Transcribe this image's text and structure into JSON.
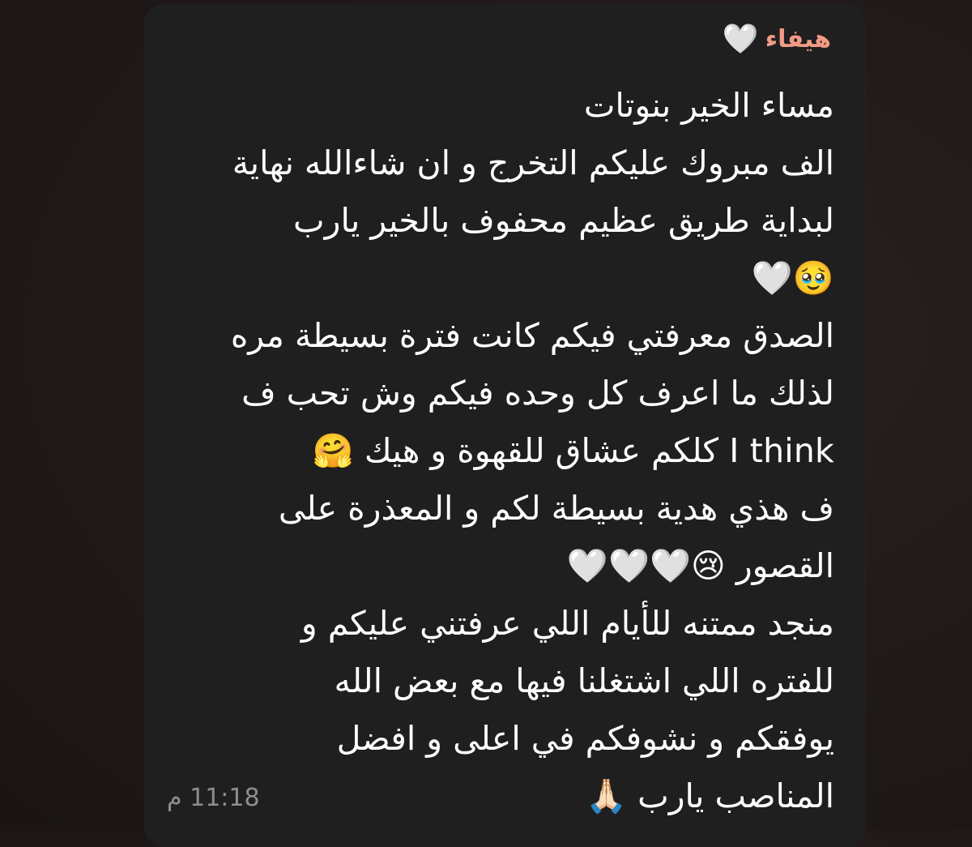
{
  "message": {
    "sender_name": "هيفاء",
    "sender_emoji": "heart-white-icon",
    "lines": [
      "مساء الخير بنوتات",
      "الف مبروك عليكم التخرج و ان شاءالله نهاية",
      "لبداية طريق عظيم محفوف بالخير يارب",
      "🥹🤍",
      "الصدق معرفتي فيكم كانت فترة بسيطة مره",
      "لذلك ما اعرف كل وحده فيكم وش تحب ف",
      "I think كلكم عشاق للقهوة و هيك 🤗",
      "ف هذي هدية بسيطة لكم و المعذرة على",
      "القصور 😢🤍🤍🤍",
      "منجد ممتنه للأيام اللي عرفتني عليكم و",
      "للفتره اللي اشتغلنا فيها مع بعض الله",
      "يوفقكم و نشوفكم في اعلى و افضل",
      "المناصب يارب 🙏🏻"
    ],
    "timestamp": "11:18 م"
  },
  "colors": {
    "background": "#221a1a",
    "bubble": "#1f1f1f",
    "sender_name": "#f39b86",
    "text": "#ffffff",
    "timestamp": "#8e8e8e"
  }
}
